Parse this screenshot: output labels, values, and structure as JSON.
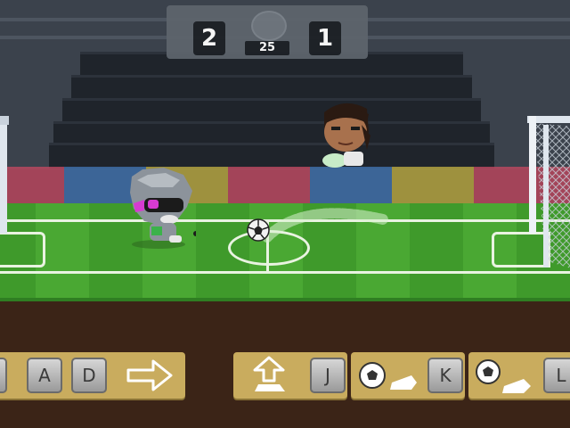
{
  "scoreboard": {
    "home_score": "2",
    "away_score": "1",
    "timer": "25"
  },
  "controls": {
    "left": {
      "key_a": "A",
      "key_d": "D"
    },
    "jump": {
      "key": "J"
    },
    "kick": {
      "key": "K"
    },
    "power": {
      "key": "L"
    }
  },
  "colors": {
    "pitch": "#3f9a2b",
    "control_panel": "#c9ac5e",
    "scoreboard": "#5d646c"
  },
  "icons": [
    "soccer-ball-icon",
    "arrow-right-icon",
    "arrow-up-jump-icon",
    "kick-icon"
  ]
}
